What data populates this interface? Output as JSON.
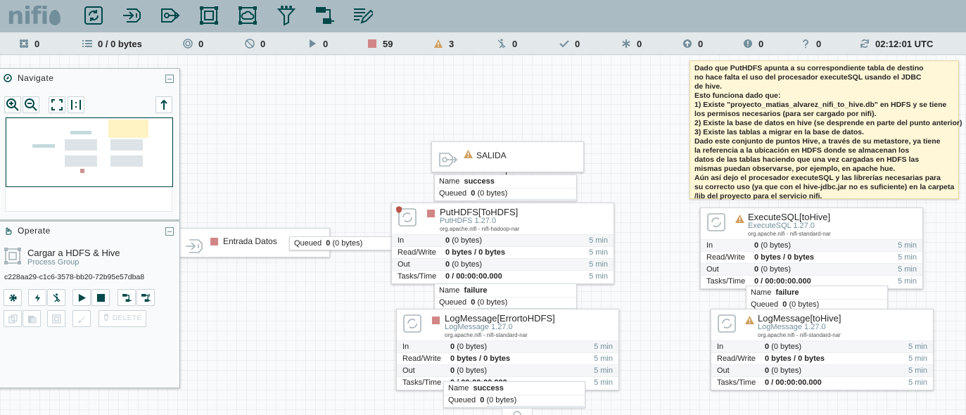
{
  "app": {
    "logo_text": "nifi"
  },
  "toolbar": {
    "items": [
      {
        "name": "processor-icon",
        "label": "Processor"
      },
      {
        "name": "input-port-icon",
        "label": "Input Port"
      },
      {
        "name": "output-port-icon",
        "label": "Output Port"
      },
      {
        "name": "process-group-icon",
        "label": "Process Group"
      },
      {
        "name": "remote-process-group-icon",
        "label": "Remote Process Group"
      },
      {
        "name": "funnel-icon",
        "label": "Funnel"
      },
      {
        "name": "template-icon",
        "label": "Template"
      },
      {
        "name": "label-icon",
        "label": "Label"
      }
    ]
  },
  "status": {
    "active_threads": "0",
    "queued": "0 / 0 bytes",
    "transmitting": "0",
    "not_transmitting": "0",
    "running": "0",
    "stopped": "59",
    "invalid": "3",
    "disabled": "0",
    "up_to_date": "0",
    "locally_modified": "0",
    "stale": "0",
    "modified_stale": "0",
    "sync_failure": "0",
    "time": "02:12:01 UTC"
  },
  "navigate": {
    "title": "Navigate"
  },
  "operate": {
    "title": "Operate",
    "group_name": "Cargar a HDFS & Hive",
    "group_type": "Process Group",
    "group_id": "c228aa29-c1c6-3578-bb20-72b95e57dba8",
    "delete_label": "DELETE"
  },
  "input_port": {
    "name": "Entrada Datos"
  },
  "output_port": {
    "name": "SALIDA"
  },
  "labels": {
    "in": "In",
    "read_write": "Read/Write",
    "out": "Out",
    "tasks_time": "Tasks/Time",
    "name": "Name",
    "queued": "Queued",
    "five_min": "5 min"
  },
  "processors": {
    "puthdfs": {
      "name": "PutHDFS[ToHDFS]",
      "type": "PutHDFS 1.27.0",
      "bundle": "org.apache.nifi - nifi-hadoop-nar",
      "in": "0",
      "in_bytes": "(0 bytes)",
      "rw": "0 bytes / 0 bytes",
      "out": "0",
      "out_bytes": "(0 bytes)",
      "tasks": "0 / 00:00:00.000"
    },
    "executesql": {
      "name": "ExecuteSQL[toHive]",
      "type": "ExecuteSQL 1.27.0",
      "bundle": "org.apache.nifi - nifi-standard-nar",
      "in": "0",
      "in_bytes": "(0 bytes)",
      "rw": "0 bytes / 0 bytes",
      "out": "0",
      "out_bytes": "(0 bytes)",
      "tasks": "0 / 00:00:00.000"
    },
    "logerror": {
      "name": "LogMessage[ErrortoHDFS]",
      "type": "LogMessage 1.27.0",
      "bundle": "org.apache.nifi - nifi-standard-nar",
      "in": "0",
      "in_bytes": "(0 bytes)",
      "rw": "0 bytes / 0 bytes",
      "out": "0",
      "out_bytes": "(0 bytes)",
      "tasks": "0 / 00:00:00.000"
    },
    "loghive": {
      "name": "LogMessage[toHive]",
      "type": "LogMessage 1.27.0",
      "bundle": "org.apache.nifi - nifi-standard-nar",
      "in": "0",
      "in_bytes": "(0 bytes)",
      "rw": "0 bytes / 0 bytes",
      "out": "0",
      "out_bytes": "(0 bytes)",
      "tasks": "0 / 00:00:00.000"
    }
  },
  "connections": {
    "success_top": {
      "name": "success",
      "count": "0",
      "bytes": "(0 bytes)"
    },
    "entrada": {
      "count": "0",
      "bytes": "(0 bytes)"
    },
    "failure_left": {
      "name": "failure",
      "count": "0",
      "bytes": "(0 bytes)"
    },
    "failure_right": {
      "name": "failure",
      "count": "0",
      "bytes": "(0 bytes)"
    },
    "success_bottom": {
      "name": "success",
      "count": "0",
      "bytes": "(0 bytes)"
    }
  },
  "note": {
    "lines": [
      "Dado que PutHDFS apunta a su correspondiente tabla de destino",
      "no hace falta el uso del procesador executeSQL usando el JDBC",
      "de hive.",
      "Esto funciona dado que:",
      "1) Existe \"proyecto_matias_alvarez_nifi_to_hive.db\" en HDFS y se tiene",
      "los permisos necesarios (para ser cargado por nifi).",
      "2) Existe la base de datos en hive (se desprende en parte del punto anterior)",
      "3) Existe las tablas a migrar en la base de datos.",
      "Dado este conjunto de puntos Hive, a través de su metastore, ya tiene",
      "la referencia a la ubicación en HDFS donde se almacenan los",
      "datos de las tablas haciendo que una vez cargadas en HDFS las",
      "mismas puedan observarse, por ejemplo, en apache hue.",
      "Aún así dejo el procesador executeSQL y las librerías necesarias para",
      "su correcto uso (ya que con el hive-jdbc.jar no es suficiente) en la carpeta",
      "/lib del proyecto para el servicio nifi."
    ]
  },
  "colors": {
    "header": "#aabbc3",
    "accent": "#004849",
    "stopped": "#d18686",
    "warning": "#ba554a",
    "note": "#fff7d7"
  }
}
